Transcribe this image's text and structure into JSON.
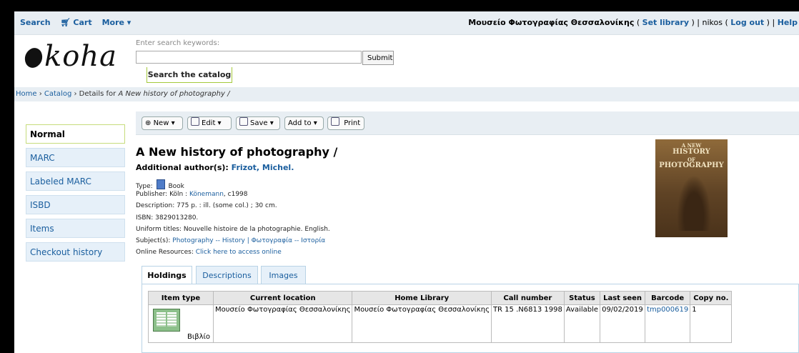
{
  "topbar": {
    "search": "Search",
    "cart": "Cart",
    "more": "More ▾",
    "library_name": "Μουσείο Φωτογραφίας Θεσσαλονίκης",
    "set_library": "Set library",
    "user": "nikos",
    "log_out": "Log out",
    "help": "Help"
  },
  "logo": {
    "text": "koha"
  },
  "search": {
    "hint": "Enter search keywords:",
    "value": "",
    "submit": "Submit",
    "tab": "Search the catalog"
  },
  "breadcrumb": {
    "home": "Home",
    "catalog": "Catalog",
    "details_prefix": "Details for",
    "title": "A New history of photography /"
  },
  "leftnav": {
    "items": [
      "Normal",
      "MARC",
      "Labeled MARC",
      "ISBD",
      "Items",
      "Checkout history"
    ]
  },
  "toolbar": {
    "new": "New ▾",
    "edit": "Edit ▾",
    "save": "Save ▾",
    "add_to": "Add to ▾",
    "print": "Print"
  },
  "record": {
    "title": "A New history of photography /",
    "author_label": "Additional author(s):",
    "author": "Frizot, Michel.",
    "type_label": "Type:",
    "type_value": "Book",
    "publisher_label": "Publisher:",
    "publisher_place": "Köln :",
    "publisher_name": "Könemann",
    "publisher_year": ", c1998",
    "description": "Description: 775 p. : ill. (some col.) ; 30 cm.",
    "isbn": "ISBN: 3829013280.",
    "uniform_title": "Uniform titles: Nouvelle histoire de la photographie. English.",
    "subjects_label": "Subject(s):",
    "subjects": "Photography -- History | Φωτογραφία -- Ιστορία",
    "online_label": "Online Resources:",
    "online_link": "Click here to access online"
  },
  "cover": {
    "line1": "A NEW",
    "line2": "HISTORY",
    "line3": "OF",
    "line4": "PHOTOGRAPHY"
  },
  "tabs": [
    "Holdings",
    "Descriptions",
    "Images"
  ],
  "holdings": {
    "columns": [
      "Item type",
      "Current location",
      "Home Library",
      "Call number",
      "Status",
      "Last seen",
      "Barcode",
      "Copy no."
    ],
    "rows": [
      {
        "item_type": "Βιβλίο",
        "current_location": "Μουσείο Φωτογραφίας Θεσσαλονίκης",
        "home_library": "Μουσείο Φωτογραφίας Θεσσαλονίκης",
        "call_number": "TR 15 .N6813 1998",
        "status": "Available",
        "last_seen": "09/02/2019",
        "barcode": "tmp000619",
        "copy_no": "1"
      }
    ]
  }
}
